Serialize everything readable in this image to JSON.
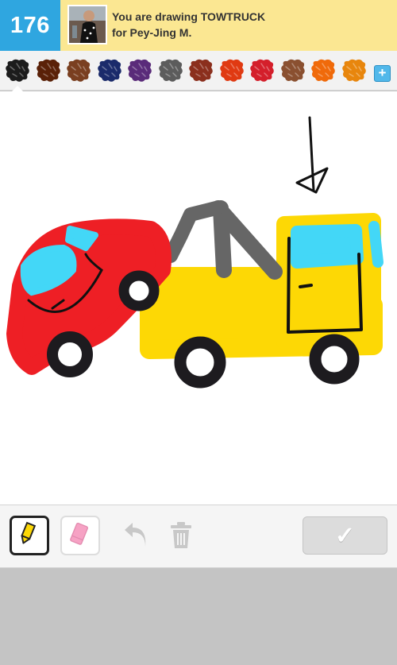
{
  "header": {
    "score": "176",
    "prompt_line1": "You are drawing TOWTRUCK",
    "prompt_line2": "for Pey-Jing M."
  },
  "palette": {
    "colors": [
      "#1c1c1c",
      "#5a2108",
      "#7a3f20",
      "#1b2b6b",
      "#5a2b7a",
      "#5c5c5c",
      "#8b2f1d",
      "#e03a12",
      "#d41f2b",
      "#8a5030",
      "#f06a0a",
      "#e8860d"
    ],
    "add_icon": "plus-icon",
    "add_label": "+"
  },
  "drawing": {
    "subject": "tow truck towing a red car"
  },
  "toolbar": {
    "pencil_icon": "pencil-icon",
    "eraser_icon": "eraser-icon",
    "undo_icon": "undo-icon",
    "trash_icon": "trash-icon",
    "done_label": "✓"
  }
}
